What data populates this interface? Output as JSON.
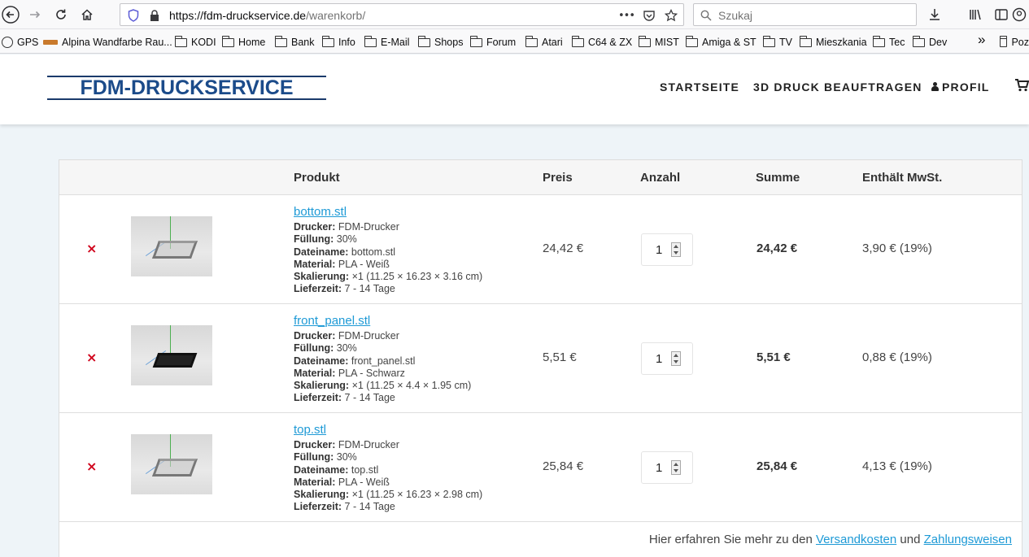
{
  "browser": {
    "url_domain": "https://fdm-druckservice.de",
    "url_path": "/warenkorb/",
    "search_placeholder": "Szukaj",
    "page_actions_label": "•••",
    "bookmarks": [
      {
        "label": "GPS",
        "icon": "globe-icon"
      },
      {
        "label": "Alpina Wandfarbe Rau...",
        "icon": "bookmark-favicon"
      },
      {
        "label": "KODI",
        "icon": "folder-icon"
      },
      {
        "label": "Home",
        "icon": "folder-icon"
      },
      {
        "label": "Bank",
        "icon": "folder-icon"
      },
      {
        "label": "Info",
        "icon": "folder-icon"
      },
      {
        "label": "E-Mail",
        "icon": "folder-icon"
      },
      {
        "label": "Shops",
        "icon": "folder-icon"
      },
      {
        "label": "Forum",
        "icon": "folder-icon"
      },
      {
        "label": "Atari",
        "icon": "folder-icon"
      },
      {
        "label": "C64 & ZX",
        "icon": "folder-icon"
      },
      {
        "label": "MIST",
        "icon": "folder-icon"
      },
      {
        "label": "Amiga & ST",
        "icon": "folder-icon"
      },
      {
        "label": "TV",
        "icon": "folder-icon"
      },
      {
        "label": "Mieszkania",
        "icon": "folder-icon"
      },
      {
        "label": "Tec",
        "icon": "folder-icon"
      },
      {
        "label": "Dev",
        "icon": "folder-icon"
      },
      {
        "label": "Poz",
        "icon": "folder-icon"
      }
    ],
    "overflow_label": "»"
  },
  "site": {
    "logo_text": "FDM-DRUCKSERVICE",
    "nav": {
      "home": "STARTSEITE",
      "order": "3D DRUCK BEAUFTRAGEN",
      "profile": "PROFIL"
    },
    "colors": {
      "link": "#1e9ad6",
      "remove": "#d0021b",
      "logo": "#1b4b8a"
    }
  },
  "cart": {
    "headers": {
      "product": "Produkt",
      "price": "Preis",
      "quantity": "Anzahl",
      "total": "Summe",
      "tax": "Enthält MwSt."
    },
    "remove_symbol": "×",
    "labels": {
      "printer": "Drucker:",
      "fill": "Füllung:",
      "filename": "Dateiname:",
      "material": "Material:",
      "scale": "Skalierung:",
      "delivery": "Lieferzeit:"
    },
    "items": [
      {
        "name": "bottom.stl",
        "printer": "FDM-Drucker",
        "fill": "30%",
        "filename": "bottom.stl",
        "material": "PLA - Weiß",
        "scale": "×1 (11.25 × 16.23 × 3.16 cm)",
        "delivery": "7 - 14 Tage",
        "price": "24,42 €",
        "quantity": "1",
        "total": "24,42 €",
        "tax": "3,90 € (19%)"
      },
      {
        "name": "front_panel.stl",
        "printer": "FDM-Drucker",
        "fill": "30%",
        "filename": "front_panel.stl",
        "material": "PLA - Schwarz",
        "scale": "×1 (11.25 × 4.4 × 1.95 cm)",
        "delivery": "7 - 14 Tage",
        "price": "5,51 €",
        "quantity": "1",
        "total": "5,51 €",
        "tax": "0,88 € (19%)"
      },
      {
        "name": "top.stl",
        "printer": "FDM-Drucker",
        "fill": "30%",
        "filename": "top.stl",
        "material": "PLA - Weiß",
        "scale": "×1 (11.25 × 16.23 × 2.98 cm)",
        "delivery": "7 - 14 Tage",
        "price": "25,84 €",
        "quantity": "1",
        "total": "25,84 €",
        "tax": "4,13 € (19%)"
      }
    ],
    "footer": {
      "prefix": "Hier erfahren Sie mehr zu den",
      "shipping_link": "Versandkosten",
      "conjunction": "und",
      "payment_link": "Zahlungsweisen"
    }
  }
}
